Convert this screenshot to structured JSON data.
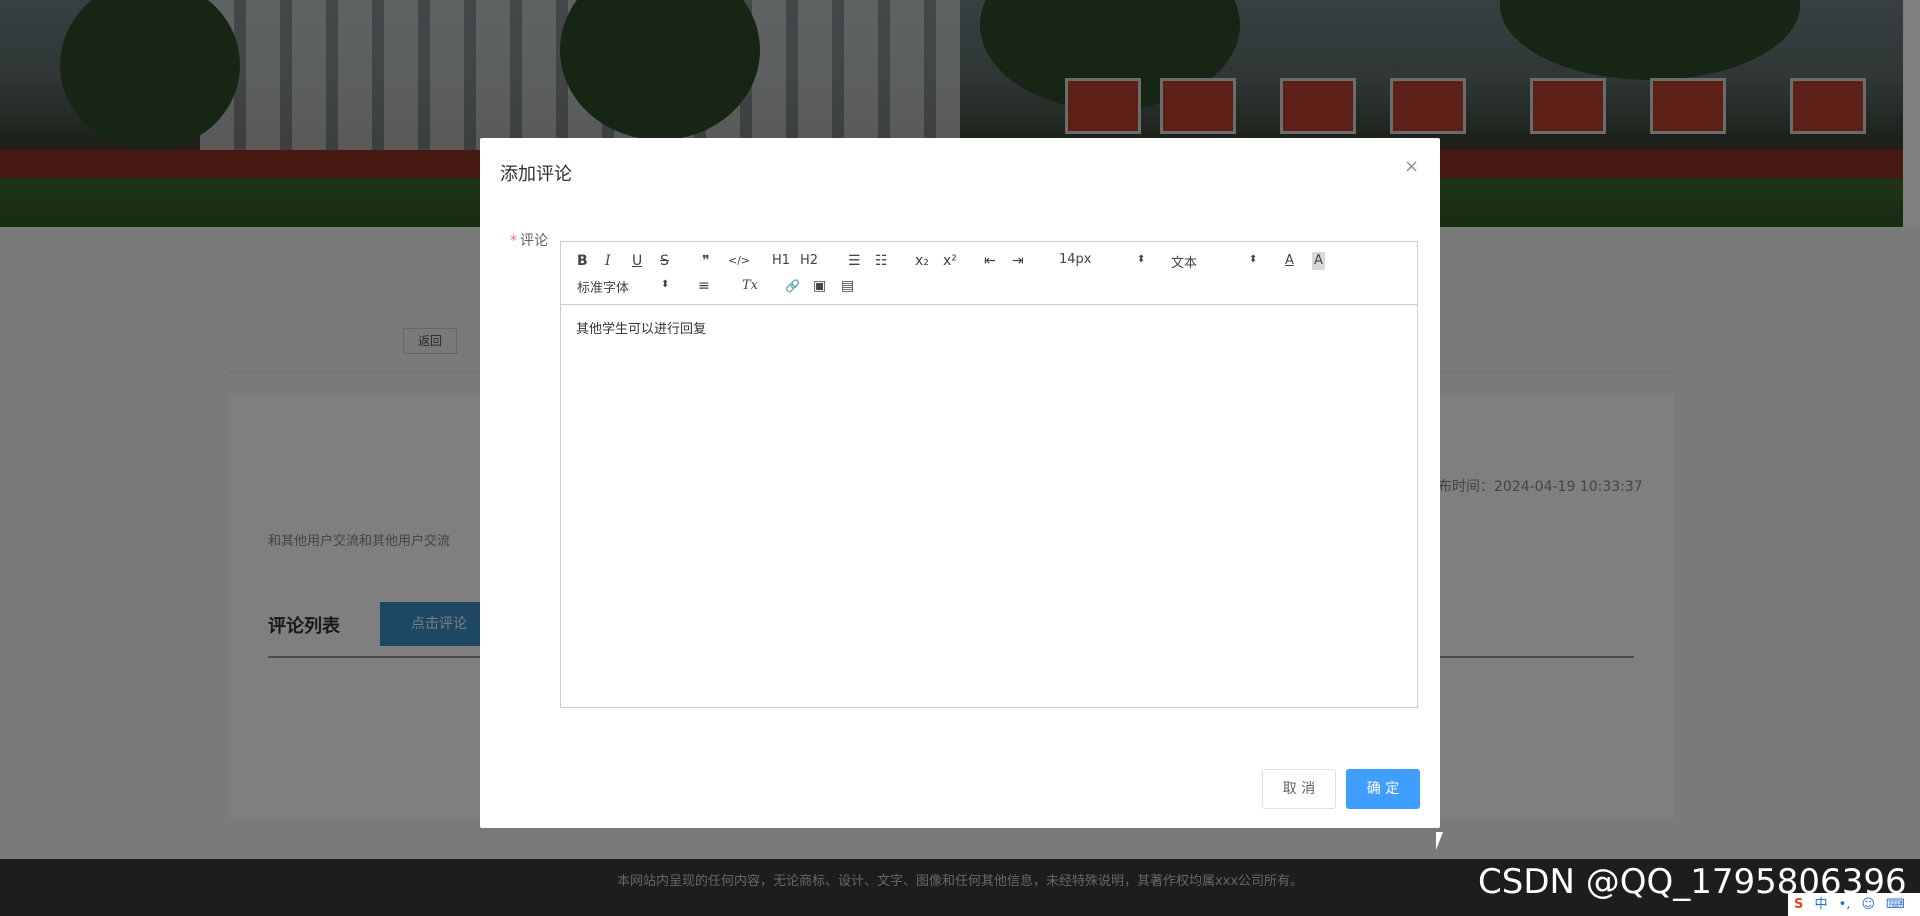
{
  "page": {
    "back_label": "返回",
    "publish_time": "布时间：2024-04-19 10:33:37",
    "summary_text": "和其他用户交流和其他用户交流",
    "comment_list_title": "评论列表",
    "comment_button_label": "点击评论",
    "footer_text": "本网站内呈现的任何内容，无论商标、设计、文字、图像和任何其他信息，未经特殊说明，其著作权均属xxx公司所有。"
  },
  "modal": {
    "title": "添加评论",
    "close_icon": "×",
    "field_label": "评论",
    "required_mark": "*",
    "editor": {
      "toolbar": {
        "bold": "B",
        "italic": "I",
        "underline": "U",
        "strike": "S",
        "blockquote": "❞",
        "code": "</>",
        "h1": "H1",
        "h2": "H2",
        "ordered_list": "☰",
        "bullet_list": "☷",
        "subscript": "x₂",
        "superscript": "x²",
        "outdent": "⇤",
        "indent": "⇥",
        "size_value": "14px",
        "header_value": "文本",
        "font_color": "A",
        "background_color": "A",
        "font_value": "标准字体",
        "align": "≡",
        "clean": "Tx",
        "link": "🔗",
        "image": "▣",
        "video": "▤",
        "select_arrow": "⬍"
      },
      "content": "其他学生可以进行回复"
    },
    "cancel_label": "取 消",
    "confirm_label": "确 定"
  },
  "overlay": {
    "watermark": "CSDN @QQ_1795806396",
    "ime_logo": "S",
    "ime_mode": "中",
    "ime_punct": "•,",
    "ime_emoji": "☺",
    "ime_keyboard": "⌨"
  },
  "colors": {
    "primary": "#409eff",
    "comment_button": "#3b8fc4",
    "required": "#f56c6c"
  }
}
